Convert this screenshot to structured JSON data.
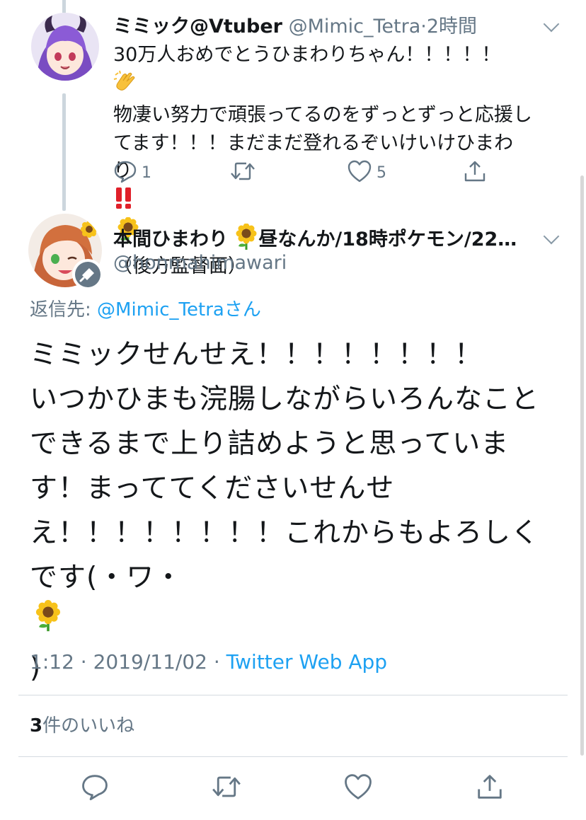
{
  "parent_tweet": {
    "display_name": "ミミック@Vtuber",
    "handle": "@Mimic_Tetra",
    "dot": "·",
    "time": "2時間",
    "text_lines": [
      "30万人おめでとうひまわりちゃん！！！！！",
      "物凄い努力で頑張ってるのをずっとずっと応援し",
      "てます！！！まだまだ登れるぞいけいけひまわ",
      "り"
    ],
    "line1_emoji": "clapping-hands",
    "line4_suffix": "（後方監督面）",
    "line4_emojis": [
      "double-exclamation",
      "sunflower"
    ],
    "reply_count": "1",
    "like_count": "5"
  },
  "main_tweet": {
    "display_name": "本間ひまわり",
    "name_suffix": "昼なんか/18時ポケモン/22…",
    "handle": "@honmahimawari",
    "reply_prefix": "返信先: ",
    "reply_mention": "@Mimic_Tetra",
    "reply_suffix": "さん",
    "text_lines": [
      "ミミックせんせえ！！！！！！！！",
      "いつかひまも浣腸しながらいろんなこと",
      "できるまで上り詰めようと思っていま",
      "す！まっててくださいせんせ",
      "え！！！！！！！！これからもよろしく",
      "です(・ワ・"
    ],
    "last_line_end": ")",
    "timestamp": "1:12 · 2019/11/02 · ",
    "source": "Twitter Web App",
    "like_count": "3",
    "like_label": "件のいいね"
  },
  "colors": {
    "text": "#14171a",
    "secondary": "#657786",
    "link": "#1da1f2",
    "divider": "#d4dbe0",
    "thread_line": "#ccd6dd"
  }
}
